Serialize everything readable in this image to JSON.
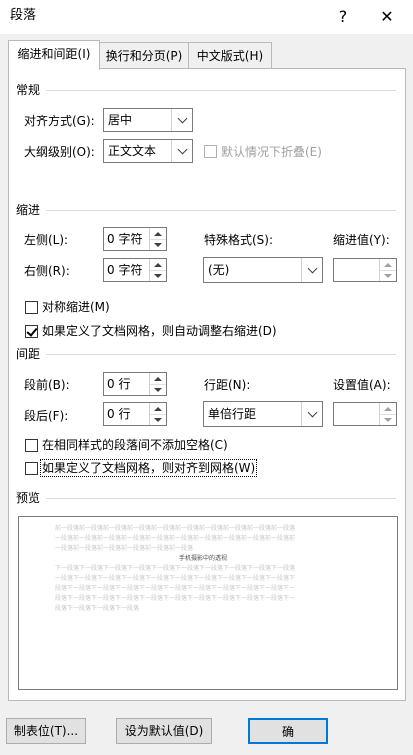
{
  "window": {
    "title": "段落",
    "help_label": "?",
    "close_label": "✕"
  },
  "tabs": [
    {
      "label": "缩进和间距(I)"
    },
    {
      "label": "换行和分页(P)"
    },
    {
      "label": "中文版式(H)"
    }
  ],
  "general": {
    "heading": "常规",
    "alignment_label": "对齐方式(G):",
    "alignment_value": "居中",
    "outline_label": "大纲级别(O):",
    "outline_value": "正文文本",
    "collapse_label": "默认情况下折叠(E)",
    "collapse_checked": false
  },
  "indent": {
    "heading": "缩进",
    "left_label": "左侧(L):",
    "left_value": "0 字符",
    "right_label": "右侧(R):",
    "right_value": "0 字符",
    "special_label": "特殊格式(S):",
    "special_value": "(无)",
    "by_label": "缩进值(Y):",
    "by_value": "",
    "mirror_label": "对称缩进(M)",
    "mirror_checked": false,
    "auto_right_label": "如果定义了文档网格，则自动调整右缩进(D)",
    "auto_right_checked": true
  },
  "spacing": {
    "heading": "间距",
    "before_label": "段前(B):",
    "before_value": "0 行",
    "after_label": "段后(F):",
    "after_value": "0 行",
    "line_spacing_label": "行距(N):",
    "line_spacing_value": "单倍行距",
    "at_label": "设置值(A):",
    "at_value": "",
    "no_space_same_style_label": "在相同样式的段落间不添加空格(C)",
    "no_space_same_style_checked": false,
    "snap_grid_label": "如果定义了文档网格，则对齐到网格(W)",
    "snap_grid_checked": false
  },
  "preview": {
    "heading": "预览",
    "prev_lines": [
      "前一段落前一段落前一段落前一段落前一段落前一段落前一段落前一段落前一段落前一段落",
      "一段落前一段落前一段落前一段落前一段落前一段落前一段落前一段落前一段落前一段落前",
      "一段落前一段落前一段落前一段落前一段落前一段落"
    ],
    "current_text": "手机摄影中的透视",
    "next_lines": [
      "下一段落下一段落下一段落下一段落下一段落下一段落下一段落下一段落下一段落下一段落",
      "一段落下一段落下一段落下一段落下一段落下一段落下一段落下一段落下一段落下一段落下",
      "段落下一段落下一段落下一段落下一段落下一段落下一段落下一段落下一段落下一段落下一",
      "段落下一段落下一段落下一段落下一段落下一段落下一段落下一段落下一段落下一段落下一",
      "段落下一段落下一段落下一段落"
    ]
  },
  "buttons": {
    "tabs_label": "制表位(T)...",
    "default_label": "设为默认值(D)",
    "ok_label": "确"
  },
  "colors": {
    "accent": "#0078d7",
    "background": "#f0f0f0",
    "panel": "#ffffff"
  }
}
